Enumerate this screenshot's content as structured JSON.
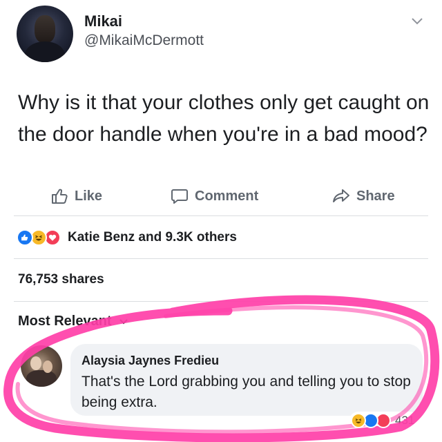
{
  "post": {
    "author_name": "Mikai",
    "author_handle": "@MikaiMcDermott",
    "text": "Why is it that your clothes only get caught on the door handle when you're in a bad mood?"
  },
  "actions": {
    "like": "Like",
    "comment": "Comment",
    "share": "Share"
  },
  "reactions": {
    "summary": "Katie Benz and 9.3K others",
    "icons": [
      "like-icon",
      "haha-icon",
      "love-icon"
    ]
  },
  "shares_count": "76,753 shares",
  "comments": {
    "sort_label": "Most Relevant",
    "items": [
      {
        "author": "Alaysia Jaynes Fredieu",
        "text": "That's the Lord grabbing you and telling you to stop being extra.",
        "reaction_count": "431"
      }
    ]
  },
  "colors": {
    "like_blue": "#1877f2",
    "love_red": "#f33e58",
    "haha_yellow": "#f7b928",
    "highlight_pink": "#ff3fa8"
  }
}
